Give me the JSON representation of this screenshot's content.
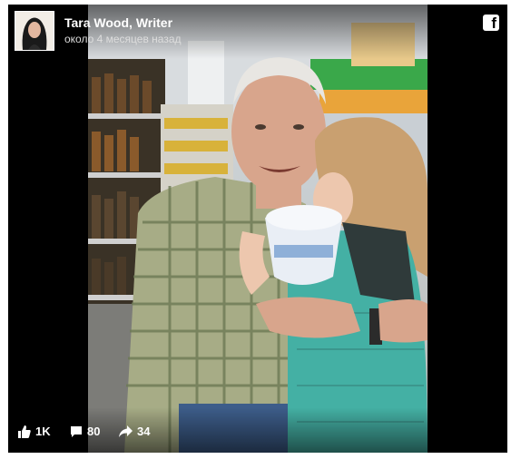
{
  "post": {
    "author_name": "Tara Wood, Writer",
    "timestamp": "около 4 месяцев назад"
  },
  "stats": {
    "likes": "1K",
    "comments": "80",
    "shares": "34"
  },
  "icons": {
    "brand": "facebook-icon",
    "like": "thumbs-up-icon",
    "comment": "comment-icon",
    "share": "share-arrow-icon"
  },
  "colors": {
    "background": "#000000",
    "text": "#ffffff"
  }
}
